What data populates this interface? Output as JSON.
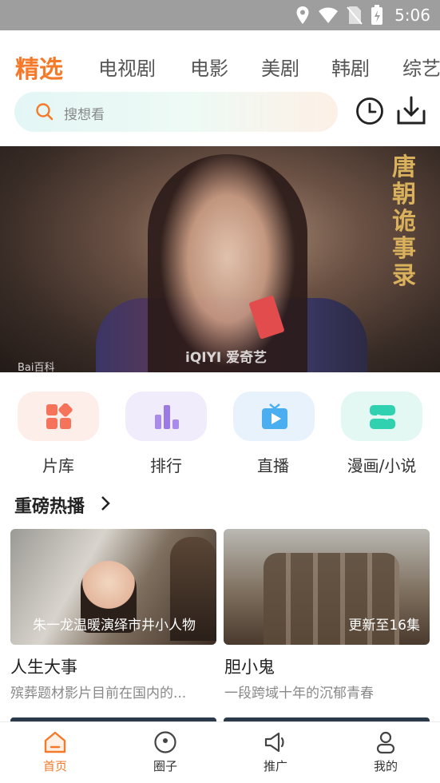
{
  "status": {
    "time": "5:06"
  },
  "tabs": [
    {
      "label": "精选"
    },
    {
      "label": "电视剧"
    },
    {
      "label": "电影"
    },
    {
      "label": "美剧"
    },
    {
      "label": "韩剧"
    },
    {
      "label": "综艺"
    }
  ],
  "search": {
    "placeholder": "搜想看"
  },
  "banner": {
    "title_art": "唐朝诡事录",
    "watermark_1": "iQIYI 爱奇艺",
    "watermark_2": "Bai百科"
  },
  "quick_links": [
    {
      "label": "片库",
      "icon": "grid-icon"
    },
    {
      "label": "排行",
      "icon": "bar-chart-icon"
    },
    {
      "label": "直播",
      "icon": "tv-icon"
    },
    {
      "label": "漫画/小说",
      "icon": "comic-icon"
    }
  ],
  "section": {
    "title": "重磅热播"
  },
  "cards": [
    {
      "title": "人生大事",
      "caption": "朱一龙温暖演绎市井小人物",
      "subtitle": "殡葬题材影片目前在国内的..."
    },
    {
      "title": "胆小鬼",
      "caption": "更新至16集",
      "subtitle": "一段跨域十年的沉郁青春"
    }
  ],
  "nav": [
    {
      "label": "首页",
      "icon": "home-icon"
    },
    {
      "label": "圈子",
      "icon": "circle-icon"
    },
    {
      "label": "推广",
      "icon": "megaphone-icon"
    },
    {
      "label": "我的",
      "icon": "user-icon"
    }
  ],
  "colors": {
    "accent": "#f47a2a"
  }
}
